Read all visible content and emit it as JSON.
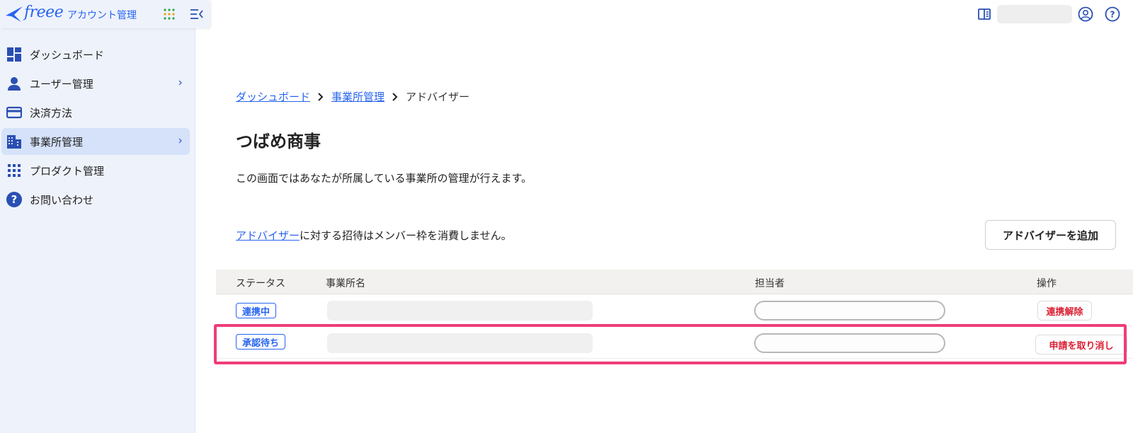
{
  "brand": {
    "wordmark": "freee",
    "subtitle": "アカウント管理",
    "accent": "#2864f0"
  },
  "sidebar": {
    "items": [
      {
        "label": "ダッシュボード",
        "icon": "dashboard-icon"
      },
      {
        "label": "ユーザー管理",
        "icon": "person-icon",
        "has_submenu": true
      },
      {
        "label": "決済方法",
        "icon": "credit-card-icon"
      },
      {
        "label": "事業所管理",
        "icon": "building-icon",
        "has_submenu": true,
        "active": true
      },
      {
        "label": "プロダクト管理",
        "icon": "grid-icon"
      },
      {
        "label": "お問い合わせ",
        "icon": "question-icon"
      }
    ]
  },
  "breadcrumb": {
    "items": [
      "ダッシュボード",
      "事業所管理"
    ],
    "current": "アドバイザー"
  },
  "page": {
    "title": "つばめ商事",
    "description": "この画面ではあなたが所属している事業所の管理が行えます。"
  },
  "advisor": {
    "link_text": "アドバイザー",
    "note_rest": "に対する招待はメンバー枠を消費しません。",
    "add_button": "アドバイザーを追加"
  },
  "table": {
    "headers": {
      "status": "ステータス",
      "office": "事業所名",
      "person": "担当者",
      "action": "操作"
    },
    "rows": [
      {
        "status": "連携中",
        "action": "連携解除"
      },
      {
        "status": "承認待ち",
        "action": "申請を取り消し"
      }
    ]
  },
  "colors": {
    "link": "#2864f0",
    "danger": "#dc1e32",
    "highlight": "#f03c78",
    "sidebar_bg": "#eef2fb"
  }
}
